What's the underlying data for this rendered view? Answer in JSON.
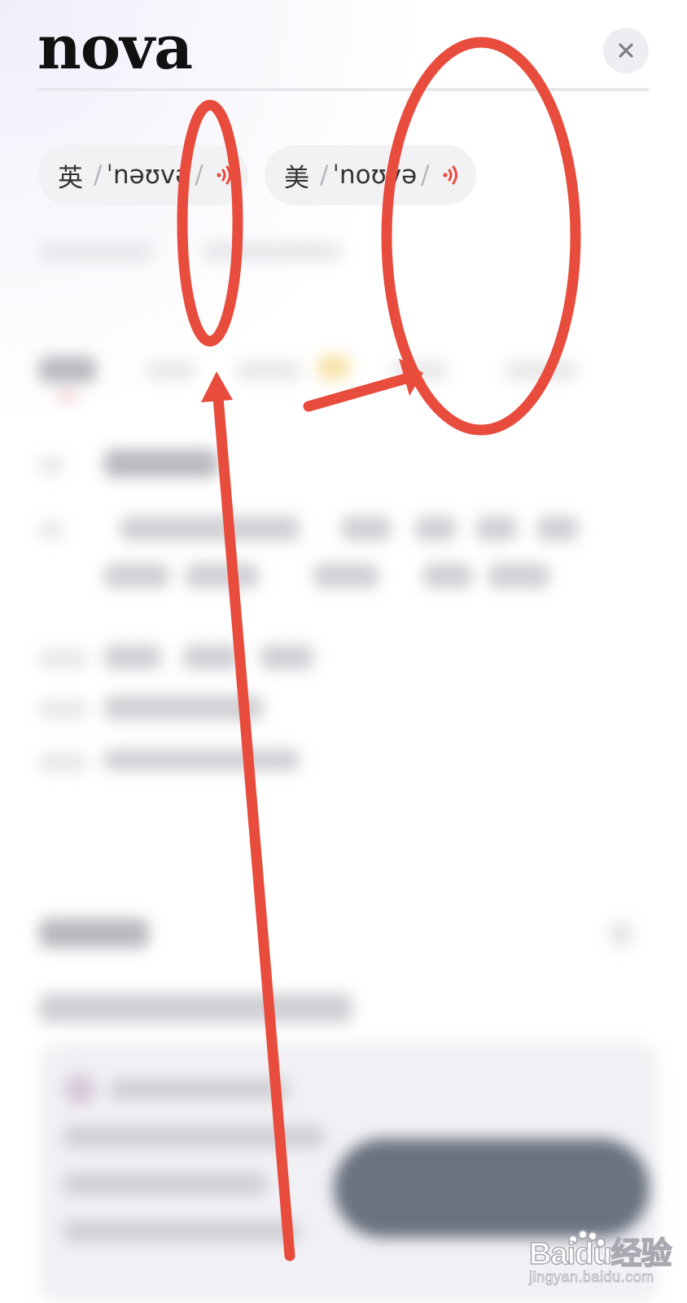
{
  "word": {
    "title": "nova"
  },
  "pronunciations": [
    {
      "region": "英",
      "ipa": "ˈnəʊvə",
      "speaker_icon": "speaker-icon"
    },
    {
      "region": "美",
      "ipa": "ˈnoʊvə",
      "speaker_icon": "speaker-icon"
    }
  ],
  "watermark": {
    "brand": "Baidu经验",
    "url": "jingyan.baidu.com"
  },
  "colors": {
    "annotation": "#e84c3d",
    "title": "#111111",
    "chip_bg": "#f2f2f5",
    "speaker": "#e84c3d"
  },
  "icons": {
    "close": "close-icon",
    "speaker": "speaker-icon"
  }
}
